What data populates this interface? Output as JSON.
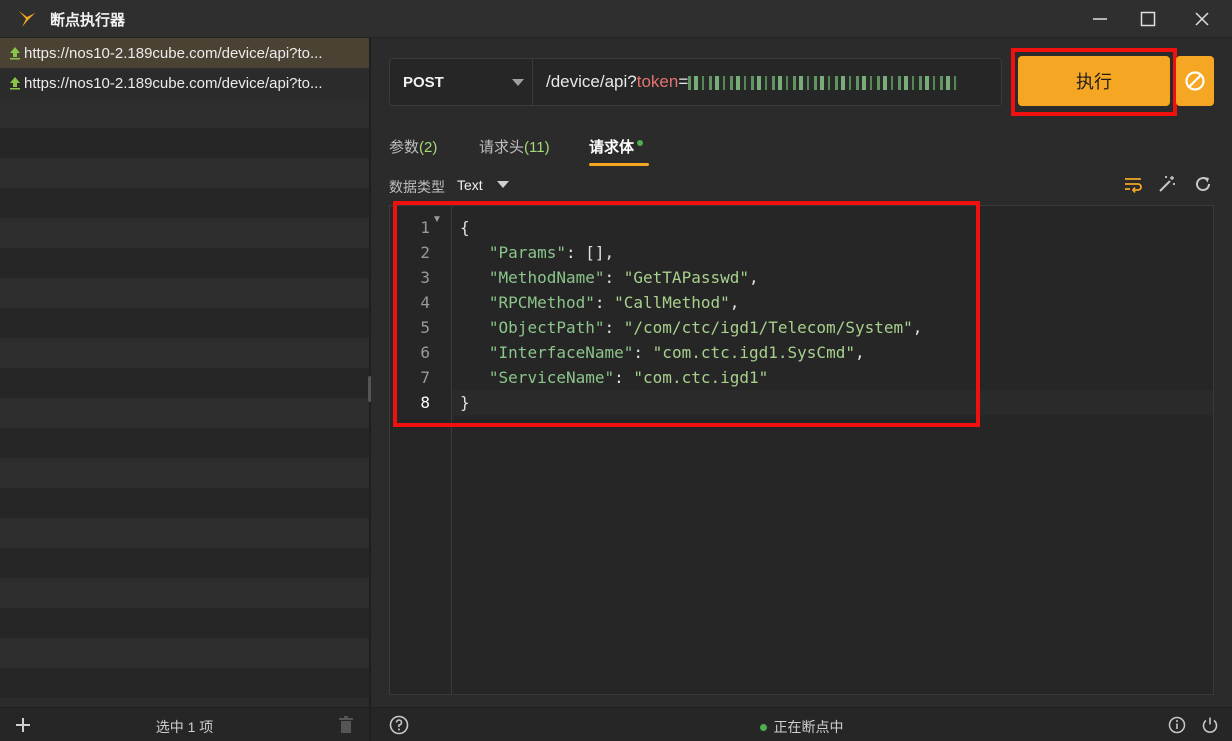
{
  "window": {
    "title": "断点执行器",
    "minimize_icon": "minimize-icon",
    "maximize_icon": "maximize-icon",
    "close_icon": "close-icon"
  },
  "request_list": {
    "items": [
      {
        "url": "https://nos10-2.189cube.com/device/api?to...",
        "selected": true
      },
      {
        "url": "https://nos10-2.189cube.com/device/api?to...",
        "selected": false
      }
    ],
    "footer": {
      "add_icon": "plus-icon",
      "selection_count": "选中 1 项",
      "trash_icon": "trash-icon"
    }
  },
  "request": {
    "method": "POST",
    "url_path": "/device/api?",
    "url_param_key": "token",
    "url_param_eq": "=",
    "execute_label": "执行",
    "cancel_icon": "cancel-icon"
  },
  "tabs": {
    "params_label": "参数",
    "params_count": "(2)",
    "headers_label": "请求头",
    "headers_count": "(11)",
    "body_label": "请求体"
  },
  "body_options": {
    "data_type_label": "数据类型",
    "data_type_value": "Text"
  },
  "editor": {
    "line_numbers": [
      "1",
      "2",
      "3",
      "4",
      "5",
      "6",
      "7",
      "8"
    ],
    "lines": [
      {
        "text": "{"
      },
      {
        "indent": "   ",
        "key": "\"Params\"",
        "sep": ": ",
        "value": "[],",
        "value_kind": "p"
      },
      {
        "indent": "   ",
        "key": "\"MethodName\"",
        "sep": ": ",
        "value": "\"GetTAPasswd\"",
        "trail": ","
      },
      {
        "indent": "   ",
        "key": "\"RPCMethod\"",
        "sep": ": ",
        "value": "\"CallMethod\"",
        "trail": ","
      },
      {
        "indent": "   ",
        "key": "\"ObjectPath\"",
        "sep": ": ",
        "value": "\"/com/ctc/igd1/Telecom/System\"",
        "trail": ","
      },
      {
        "indent": "   ",
        "key": "\"InterfaceName\"",
        "sep": ": ",
        "value": "\"com.ctc.igd1.SysCmd\"",
        "trail": ","
      },
      {
        "indent": "   ",
        "key": "\"ServiceName\"",
        "sep": ": ",
        "value": "\"com.ctc.igd1\"",
        "trail": ""
      },
      {
        "text": "}"
      }
    ]
  },
  "status_bar": {
    "status_text": "正在断点中",
    "status_color": "#4caf50"
  },
  "colors": {
    "accent": "#f5a623",
    "highlight_box": "#f01010"
  }
}
